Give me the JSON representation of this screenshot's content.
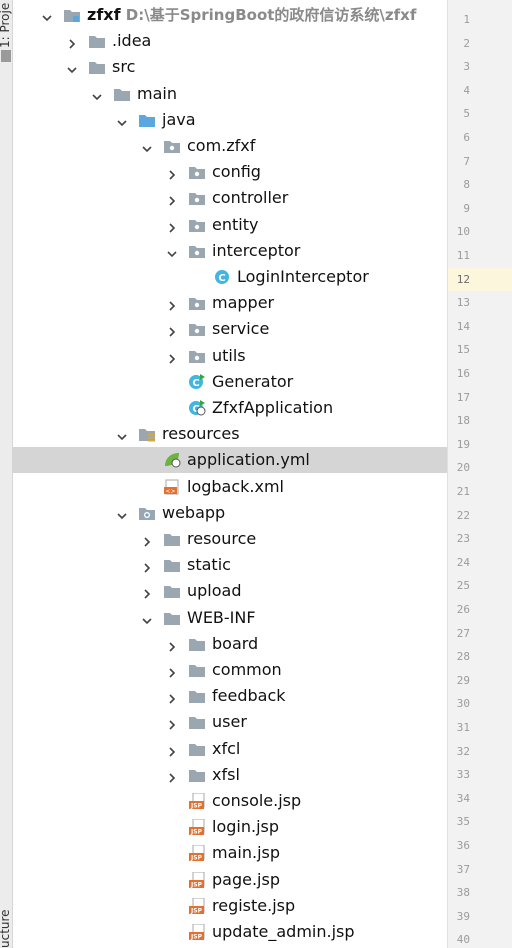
{
  "sidebar": {
    "project_tab": "1: Proje",
    "structure_tab": "ucture"
  },
  "root": {
    "name": "zfxf",
    "path": "D:\\基于SpringBoot的政府信访系统\\zfxf"
  },
  "tree": [
    {
      "label": "zfxf",
      "depth": 0,
      "arrow": "down",
      "icon": "module-folder-icon",
      "bold": true
    },
    {
      "label": ".idea",
      "depth": 1,
      "arrow": "right",
      "icon": "folder-icon"
    },
    {
      "label": "src",
      "depth": 1,
      "arrow": "down",
      "icon": "folder-icon"
    },
    {
      "label": "main",
      "depth": 2,
      "arrow": "down",
      "icon": "folder-icon"
    },
    {
      "label": "java",
      "depth": 3,
      "arrow": "down",
      "icon": "source-folder-icon"
    },
    {
      "label": "com.zfxf",
      "depth": 4,
      "arrow": "down",
      "icon": "package-icon"
    },
    {
      "label": "config",
      "depth": 5,
      "arrow": "right",
      "icon": "package-icon"
    },
    {
      "label": "controller",
      "depth": 5,
      "arrow": "right",
      "icon": "package-icon"
    },
    {
      "label": "entity",
      "depth": 5,
      "arrow": "right",
      "icon": "package-icon"
    },
    {
      "label": "interceptor",
      "depth": 5,
      "arrow": "down",
      "icon": "package-icon"
    },
    {
      "label": "LoginInterceptor",
      "depth": 6,
      "arrow": "none",
      "icon": "class-icon"
    },
    {
      "label": "mapper",
      "depth": 5,
      "arrow": "right",
      "icon": "package-icon"
    },
    {
      "label": "service",
      "depth": 5,
      "arrow": "right",
      "icon": "package-icon"
    },
    {
      "label": "utils",
      "depth": 5,
      "arrow": "right",
      "icon": "package-icon"
    },
    {
      "label": "Generator",
      "depth": 5,
      "arrow": "none",
      "icon": "runnable-class-icon"
    },
    {
      "label": "ZfxfApplication",
      "depth": 5,
      "arrow": "none",
      "icon": "spring-boot-class-icon"
    },
    {
      "label": "resources",
      "depth": 3,
      "arrow": "down",
      "icon": "resources-folder-icon"
    },
    {
      "label": "application.yml",
      "depth": 4,
      "arrow": "none",
      "icon": "spring-yml-icon",
      "selected": true
    },
    {
      "label": "logback.xml",
      "depth": 4,
      "arrow": "none",
      "icon": "xml-file-icon"
    },
    {
      "label": "webapp",
      "depth": 3,
      "arrow": "down",
      "icon": "web-folder-icon"
    },
    {
      "label": "resource",
      "depth": 4,
      "arrow": "right",
      "icon": "folder-icon"
    },
    {
      "label": "static",
      "depth": 4,
      "arrow": "right",
      "icon": "folder-icon"
    },
    {
      "label": "upload",
      "depth": 4,
      "arrow": "right",
      "icon": "folder-icon"
    },
    {
      "label": "WEB-INF",
      "depth": 4,
      "arrow": "down",
      "icon": "folder-icon"
    },
    {
      "label": "board",
      "depth": 5,
      "arrow": "right",
      "icon": "folder-icon"
    },
    {
      "label": "common",
      "depth": 5,
      "arrow": "right",
      "icon": "folder-icon"
    },
    {
      "label": "feedback",
      "depth": 5,
      "arrow": "right",
      "icon": "folder-icon"
    },
    {
      "label": "user",
      "depth": 5,
      "arrow": "right",
      "icon": "folder-icon"
    },
    {
      "label": "xfcl",
      "depth": 5,
      "arrow": "right",
      "icon": "folder-icon"
    },
    {
      "label": "xfsl",
      "depth": 5,
      "arrow": "right",
      "icon": "folder-icon"
    },
    {
      "label": "console.jsp",
      "depth": 5,
      "arrow": "none",
      "icon": "jsp-file-icon"
    },
    {
      "label": "login.jsp",
      "depth": 5,
      "arrow": "none",
      "icon": "jsp-file-icon"
    },
    {
      "label": "main.jsp",
      "depth": 5,
      "arrow": "none",
      "icon": "jsp-file-icon"
    },
    {
      "label": "page.jsp",
      "depth": 5,
      "arrow": "none",
      "icon": "jsp-file-icon"
    },
    {
      "label": "registe.jsp",
      "depth": 5,
      "arrow": "none",
      "icon": "jsp-file-icon"
    },
    {
      "label": "update_admin.jsp",
      "depth": 5,
      "arrow": "none",
      "icon": "jsp-file-icon"
    }
  ],
  "gutter": {
    "line_numbers": [
      "1",
      "2",
      "3",
      "4",
      "5",
      "6",
      "7",
      "8",
      "9",
      "10",
      "11",
      "12",
      "13",
      "14",
      "15",
      "16",
      "17",
      "18",
      "19",
      "20",
      "21",
      "22",
      "23",
      "24",
      "25",
      "26",
      "27",
      "28",
      "29",
      "30",
      "31",
      "32",
      "33",
      "34",
      "35",
      "36",
      "37",
      "38",
      "39",
      "40"
    ],
    "current_line": "12"
  },
  "colors": {
    "folder": "#9aa7b0",
    "source_folder": "#5ca7dd",
    "class": "#40b6e0",
    "spring": "#6db33f",
    "jsp": "#e2702f",
    "selection": "#d5d5d5",
    "current_line_bg": "#fcf7dc"
  }
}
